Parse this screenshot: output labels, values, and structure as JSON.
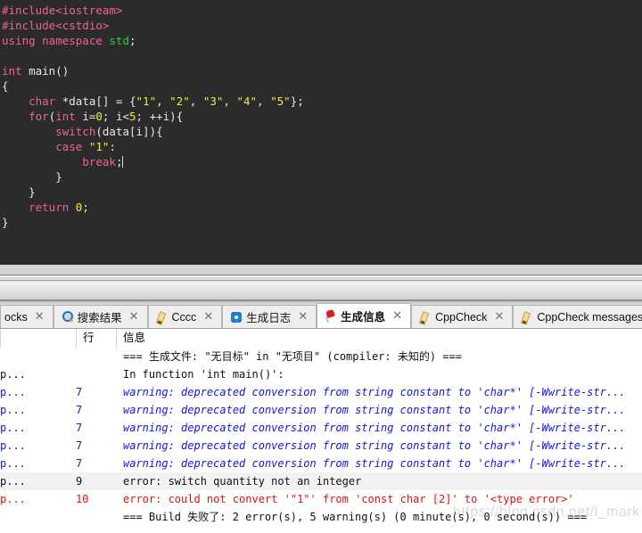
{
  "editor": {
    "background": "#2b2b2b",
    "colors": {
      "keyword": "#f0609a",
      "string": "#f5e642",
      "namespace": "#36c93b",
      "plain": "#e8e8e8"
    },
    "lines": [
      [
        {
          "t": "#include<iostream>",
          "c": "kw"
        }
      ],
      [
        {
          "t": "#include<cstdio>",
          "c": "kw"
        }
      ],
      [
        {
          "t": "using namespace ",
          "c": "kw"
        },
        {
          "t": "std",
          "c": "ns"
        },
        {
          "t": ";",
          "c": "plain"
        }
      ],
      [
        {
          "t": "",
          "c": "plain"
        }
      ],
      [
        {
          "t": "int",
          "c": "kw"
        },
        {
          "t": " main()",
          "c": "plain"
        }
      ],
      [
        {
          "t": "{",
          "c": "plain"
        }
      ],
      [
        {
          "t": "    ",
          "c": "plain"
        },
        {
          "t": "char",
          "c": "kw"
        },
        {
          "t": " *data[] = {",
          "c": "plain"
        },
        {
          "t": "\"1\"",
          "c": "str"
        },
        {
          "t": ", ",
          "c": "plain"
        },
        {
          "t": "\"2\"",
          "c": "str"
        },
        {
          "t": ", ",
          "c": "plain"
        },
        {
          "t": "\"3\"",
          "c": "str"
        },
        {
          "t": ", ",
          "c": "plain"
        },
        {
          "t": "\"4\"",
          "c": "str"
        },
        {
          "t": ", ",
          "c": "plain"
        },
        {
          "t": "\"5\"",
          "c": "str"
        },
        {
          "t": "};",
          "c": "plain"
        }
      ],
      [
        {
          "t": "    ",
          "c": "plain"
        },
        {
          "t": "for",
          "c": "kw"
        },
        {
          "t": "(",
          "c": "plain"
        },
        {
          "t": "int",
          "c": "kw"
        },
        {
          "t": " i=",
          "c": "plain"
        },
        {
          "t": "0",
          "c": "str"
        },
        {
          "t": "; i<",
          "c": "plain"
        },
        {
          "t": "5",
          "c": "str"
        },
        {
          "t": "; ++i){",
          "c": "plain"
        }
      ],
      [
        {
          "t": "        ",
          "c": "plain"
        },
        {
          "t": "switch",
          "c": "kw"
        },
        {
          "t": "(data[i]){",
          "c": "plain"
        }
      ],
      [
        {
          "t": "        ",
          "c": "plain"
        },
        {
          "t": "case",
          "c": "kw"
        },
        {
          "t": " ",
          "c": "plain"
        },
        {
          "t": "\"1\"",
          "c": "str"
        },
        {
          "t": ":",
          "c": "plain"
        }
      ],
      [
        {
          "t": "            ",
          "c": "plain"
        },
        {
          "t": "break",
          "c": "kw"
        },
        {
          "t": ";",
          "c": "plain"
        },
        {
          "t": "|CARET|",
          "c": "caret"
        }
      ],
      [
        {
          "t": "        }",
          "c": "plain"
        }
      ],
      [
        {
          "t": "    }",
          "c": "plain"
        }
      ],
      [
        {
          "t": "    ",
          "c": "plain"
        },
        {
          "t": "return",
          "c": "kw"
        },
        {
          "t": " ",
          "c": "plain"
        },
        {
          "t": "0",
          "c": "str"
        },
        {
          "t": ";",
          "c": "plain"
        }
      ],
      [
        {
          "t": "}",
          "c": "plain"
        }
      ]
    ]
  },
  "tabs": [
    {
      "label": "ocks",
      "icon": "none",
      "closable": true,
      "active": false,
      "partial": true
    },
    {
      "label": "搜索结果",
      "icon": "search-icon",
      "closable": true,
      "active": false,
      "partial": false
    },
    {
      "label": "Cccc",
      "icon": "pencil-icon",
      "closable": true,
      "active": false,
      "partial": false
    },
    {
      "label": "生成日志",
      "icon": "gear-icon",
      "closable": true,
      "active": false,
      "partial": false
    },
    {
      "label": "生成信息",
      "icon": "pin-icon",
      "closable": true,
      "active": true,
      "partial": false
    },
    {
      "label": "CppCheck",
      "icon": "pencil-icon",
      "closable": true,
      "active": false,
      "partial": false
    },
    {
      "label": "CppCheck messages",
      "icon": "pencil-icon",
      "closable": false,
      "active": false,
      "partial": false
    }
  ],
  "messages": {
    "columns": {
      "file": "",
      "line": "行",
      "message": "信息"
    },
    "rows": [
      {
        "file": "",
        "line": "",
        "message": "=== 生成文件: \"无目标\" in \"无项目\" (compiler: 未知的) ===",
        "style": "plain",
        "highlight": false
      },
      {
        "file": "p...",
        "line": "",
        "message": "In function 'int main()':",
        "style": "plain",
        "highlight": false
      },
      {
        "file": "p...",
        "line": "7",
        "message": "warning: deprecated conversion from string constant to 'char*' [-Wwrite-str...",
        "style": "warning",
        "highlight": false
      },
      {
        "file": "p...",
        "line": "7",
        "message": "warning: deprecated conversion from string constant to 'char*' [-Wwrite-str...",
        "style": "warning",
        "highlight": false
      },
      {
        "file": "p...",
        "line": "7",
        "message": "warning: deprecated conversion from string constant to 'char*' [-Wwrite-str...",
        "style": "warning",
        "highlight": false
      },
      {
        "file": "p...",
        "line": "7",
        "message": "warning: deprecated conversion from string constant to 'char*' [-Wwrite-str...",
        "style": "warning",
        "highlight": false
      },
      {
        "file": "p...",
        "line": "7",
        "message": "warning: deprecated conversion from string constant to 'char*' [-Wwrite-str...",
        "style": "warning",
        "highlight": false
      },
      {
        "file": "p...",
        "line": "9",
        "message": "error: switch quantity not an integer",
        "style": "errdark",
        "highlight": true
      },
      {
        "file": "p...",
        "line": "10",
        "message": "error: could not convert '\"1\"' from 'const char [2]' to '<type error>'",
        "style": "error",
        "highlight": false
      },
      {
        "file": "",
        "line": "",
        "message": "=== Build 失败了: 2 error(s), 5 warning(s) (0 minute(s), 0 second(s)) ===",
        "style": "plain",
        "highlight": false
      }
    ]
  },
  "watermark": {
    "text": "https://blog.csdn.net/l_mark"
  }
}
